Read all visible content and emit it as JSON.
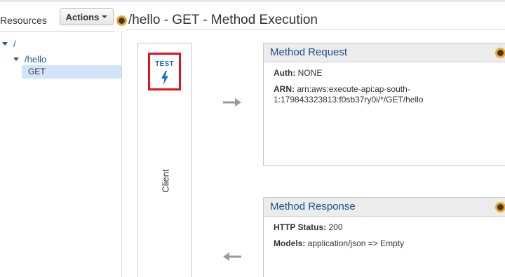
{
  "sidebar": {
    "title": "Resources",
    "actions_label": "Actions",
    "tree": {
      "root": "/",
      "child": "/hello",
      "method": "GET"
    }
  },
  "main": {
    "title": "/hello - GET - Method Execution",
    "client": {
      "test_label": "TEST",
      "label": "Client"
    },
    "method_request": {
      "title": "Method Request",
      "auth_label": "Auth:",
      "auth_value": "NONE",
      "arn_label": "ARN:",
      "arn_value_line1": "arn:aws:execute-api:ap-south-",
      "arn_value_line2": "1:179843323813:f0sb37ry0i/*/GET/hello"
    },
    "method_response": {
      "title": "Method Response",
      "status_label": "HTTP Status:",
      "status_value": "200",
      "models_label": "Models:",
      "models_value": "application/json => Empty"
    }
  },
  "colors": {
    "link_blue": "#1a57a5",
    "panel_title_blue": "#1a4f8b",
    "test_border_red": "#e0121b",
    "dot_orange": "#f5a623",
    "selected_bg": "#d2e5f8"
  },
  "icons": [
    "caret-down-icon",
    "lightning-bolt-icon",
    "arrow-right-icon",
    "arrow-left-icon",
    "status-dot-icon"
  ]
}
